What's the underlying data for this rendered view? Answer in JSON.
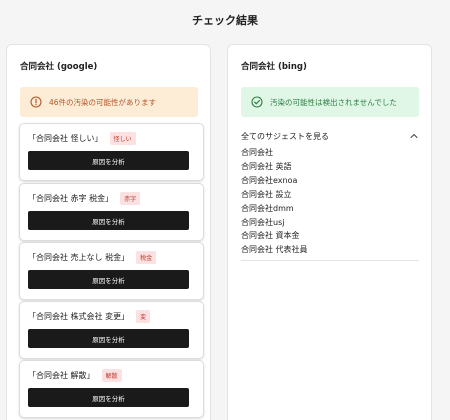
{
  "page": {
    "title": "チェック結果"
  },
  "google": {
    "title": "合同会社 (google)",
    "alert": "46件の汚染の可能性があります",
    "analyze_label": "原因を分析",
    "results": [
      {
        "text": "「合同会社 怪しい」",
        "tag": "怪しい"
      },
      {
        "text": "「合同会社 赤字 税金」",
        "tag": "赤字"
      },
      {
        "text": "「合同会社 売上なし 税金」",
        "tag": "税金"
      },
      {
        "text": "「合同会社 株式会社 変更」",
        "tag": "変"
      },
      {
        "text": "「合同会社 解散」",
        "tag": "解散"
      }
    ]
  },
  "bing": {
    "title": "合同会社 (bing)",
    "alert": "汚染の可能性は検出されませんでした",
    "toggle_label": "全てのサジェストを見る",
    "suggestions": [
      "合同会社",
      "合同会社 英語",
      "合同会社exnoa",
      "合同会社 設立",
      "合同会社dmm",
      "合同会社usj",
      "合同会社 資本金",
      "合同会社 代表社員"
    ]
  },
  "colors": {
    "warn_bg": "#fdecd6",
    "warn_text": "#b2562a",
    "ok_bg": "#e0f6e6",
    "ok_text": "#2e7d45",
    "tag_bg": "#fbe1e1",
    "tag_text": "#c0392b",
    "button_bg": "#1a1a1a"
  },
  "icons": {
    "warn": "alert-circle-icon",
    "ok": "check-circle-icon",
    "toggle": "chevron-up-icon"
  }
}
